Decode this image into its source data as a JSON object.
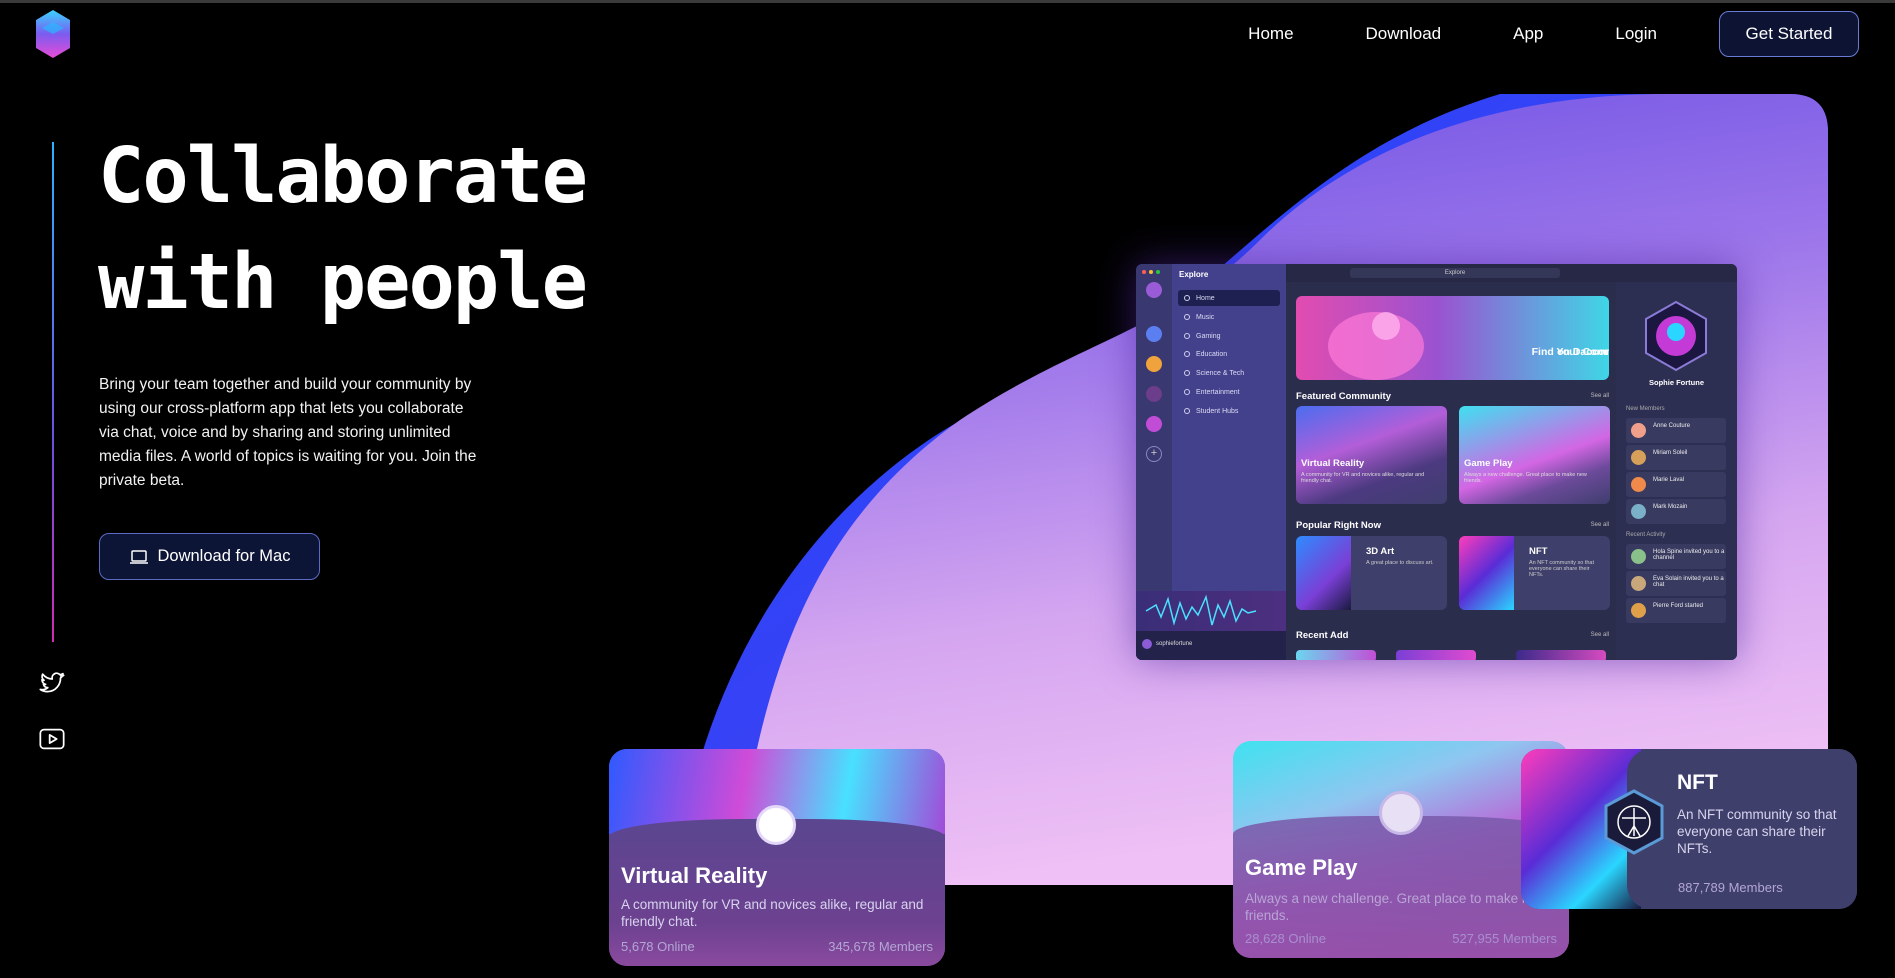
{
  "nav": {
    "home": "Home",
    "download": "Download",
    "app": "App",
    "login": "Login",
    "get_started": "Get Started"
  },
  "hero": {
    "title": "Collaborate\nwith people",
    "description": "Bring your team together and build your community by using our cross-platform app that lets you collaborate via chat, voice and by sharing and storing unlimited media files. A world of topics is waiting for you. Join the private beta.",
    "download_button": "Download for Mac"
  },
  "social": {
    "icons": [
      "twitter-icon",
      "youtube-icon"
    ]
  },
  "colors": {
    "accent": "#6d5ae6",
    "button_bg": "#0d1333",
    "blob_blue": "#1d4fff",
    "blob_pink": "#e8b8f4"
  },
  "app_preview": {
    "sidebar_title": "Explore",
    "menu": [
      "Home",
      "Music",
      "Gaming",
      "Education",
      "Science & Tech",
      "Entertainment",
      "Student Hubs"
    ],
    "search_placeholder": "Explore",
    "username": "sophiefortune",
    "banner_line1": "Find Your Community",
    "banner_line2": "on Daccord",
    "featured_title": "Featured Community",
    "see_all": "See all",
    "featured": [
      {
        "title": "Virtual Reality",
        "desc": "A community for VR and novices alike, regular and friendly chat."
      },
      {
        "title": "Game Play",
        "desc": "Always a new challenge. Great place to make new friends."
      }
    ],
    "popular_title": "Popular Right Now",
    "popular": [
      {
        "title": "3D Art",
        "desc": "A great place to discuss art."
      },
      {
        "title": "NFT",
        "desc": "An NFT community so that everyone can share their NFTs."
      }
    ],
    "recent_title": "Recent Add",
    "profile_name": "Sophie Fortune",
    "new_members_title": "New Members",
    "members": [
      "Anne Couture",
      "Miriam Soleil",
      "Marie Laval",
      "Mark Mozain"
    ],
    "recent_activity_title": "Recent Activity",
    "activity": [
      "Hola Spine invited you to a channel",
      "Eva Solain invited you to a chat",
      "Pierre Ford started"
    ]
  },
  "cards": {
    "vr": {
      "title": "Virtual Reality",
      "desc": "A community for VR and novices alike, regular and friendly chat.",
      "online": "5,678 Online",
      "members": "345,678 Members"
    },
    "game": {
      "title": "Game Play",
      "desc": "Always a new challenge. Great place to make n",
      "desc2": "friends.",
      "online": "28,628 Online",
      "members": "527,955 Members"
    },
    "nft": {
      "title": "NFT",
      "desc": "An NFT community so that everyone can share their NFTs.",
      "members": "887,789 Members"
    }
  }
}
